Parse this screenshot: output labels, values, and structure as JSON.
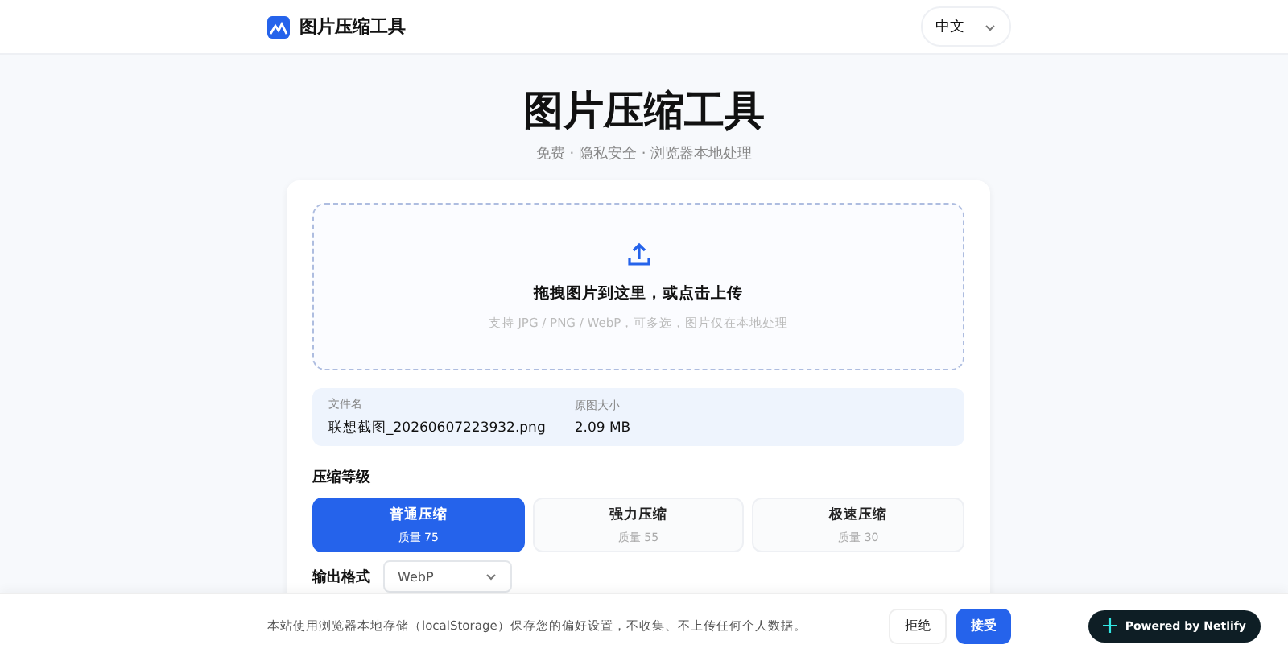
{
  "header": {
    "brand": "图片压缩工具",
    "language": "中文"
  },
  "hero": {
    "title": "图片压缩工具",
    "subtitle": "免费 · 隐私安全 · 浏览器本地处理"
  },
  "dropzone": {
    "title": "拖拽图片到这里，或点击上传",
    "hint": "支持 JPG / PNG / WebP，可多选，图片仅在本地处理"
  },
  "file_info": [
    {
      "label": "文件名",
      "value": "联想截图_20260607223932.png"
    },
    {
      "label": "原图大小",
      "value": "2.09 MB"
    }
  ],
  "compression": {
    "label": "压缩等级",
    "options": [
      {
        "name": "普通压缩",
        "quality": "质量 75",
        "selected": true
      },
      {
        "name": "强力压缩",
        "quality": "质量 55",
        "selected": false
      },
      {
        "name": "极速压缩",
        "quality": "质量 30",
        "selected": false
      }
    ]
  },
  "output": {
    "label": "输出格式",
    "value": "WebP"
  },
  "cookie_banner": {
    "text": "本站使用浏览器本地存储（localStorage）保存您的偏好设置，不收集、不上传任何个人数据。",
    "decline": "拒绝",
    "accept": "接受"
  },
  "badge": {
    "text": "Powered by Netlify"
  }
}
